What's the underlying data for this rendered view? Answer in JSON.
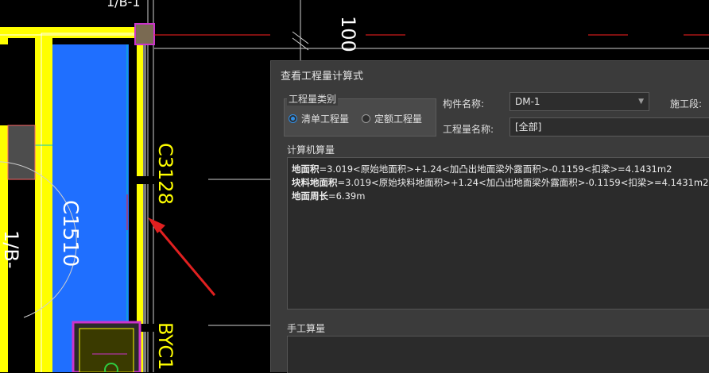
{
  "cad": {
    "label_top": "1/B-1",
    "label_100": "100",
    "label_c3128": "C3128",
    "label_c1510": "C1510",
    "label_left": "1/B-",
    "label_byc": "BYC1"
  },
  "dialog": {
    "title": "查看工程量计算式",
    "category_group_title": "工程量类别",
    "radio_list": "清单工程量",
    "radio_quota": "定额工程量",
    "component_name_label": "构件名称:",
    "component_name_value": "DM-1",
    "stage_label": "施工段:",
    "quantity_name_label": "工程量名称:",
    "quantity_name_value": "[全部]",
    "computer_calc_title": "计算机算量",
    "calc_lines": [
      {
        "name": "地面积",
        "expr": "=3.019<原始地面积>+1.24<加凸出地面梁外露面积>-0.1159<扣梁>=4.1431m2"
      },
      {
        "name": "块料地面积",
        "expr": "=3.019<原始块料地面积>+1.24<加凸出地面梁外露面积>-0.1159<扣梁>=4.1431m2"
      },
      {
        "name": "地面周长",
        "expr": "=6.39m"
      }
    ],
    "manual_calc_title": "手工算量"
  },
  "colors": {
    "wall_yellow": "#ffff00",
    "room_blue": "#1f6fff",
    "arrow_red": "#e02020",
    "dialog_bg": "#3b3b3b",
    "radio_accent": "#2f8ee6"
  }
}
